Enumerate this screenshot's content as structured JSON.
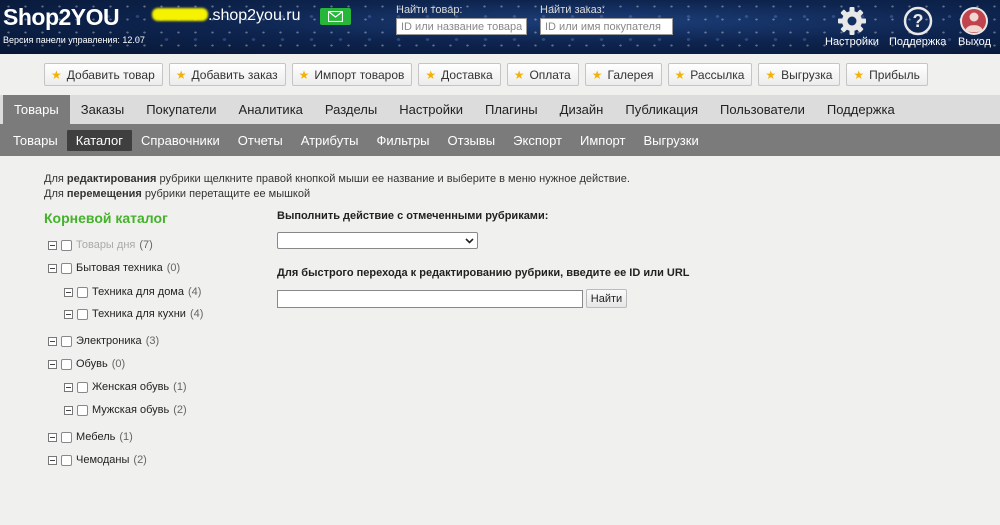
{
  "header": {
    "logo": "Shop2YOU",
    "version": "Версия панели управления: 12.07",
    "domain_visible": ".shop2you.ru",
    "search_product": {
      "label": "Найти товар:",
      "placeholder": "ID или название товара"
    },
    "search_order": {
      "label": "Найти заказ:",
      "placeholder": "ID или имя покупателя"
    },
    "nav": {
      "settings": "Настройки",
      "support": "Поддержка",
      "logout": "Выход"
    },
    "colors": {
      "accent_green": "#27b53a",
      "avatar_red": "#c0434e"
    }
  },
  "quick_buttons": [
    "Добавить товар",
    "Добавить заказ",
    "Импорт товаров",
    "Доставка",
    "Оплата",
    "Галерея",
    "Рассылка",
    "Выгрузка",
    "Прибыль"
  ],
  "main_menu": [
    "Товары",
    "Заказы",
    "Покупатели",
    "Аналитика",
    "Разделы",
    "Настройки",
    "Плагины",
    "Дизайн",
    "Публикация",
    "Пользователи",
    "Поддержка"
  ],
  "sub_menu": [
    "Товары",
    "Каталог",
    "Справочники",
    "Отчеты",
    "Атрибуты",
    "Фильтры",
    "Отзывы",
    "Экспорт",
    "Импорт",
    "Выгрузки"
  ],
  "hints": {
    "line1_pre": "Для ",
    "line1_bold": "редактирования",
    "line1_post": " рубрики щелкните правой кнопкой мыши ее название и выберите в меню нужное действие.",
    "line2_pre": "Для ",
    "line2_bold": "перемещения",
    "line2_post": " рубрики перетащите ее мышкой"
  },
  "tree": {
    "title": "Корневой каталог",
    "items": [
      {
        "name": "Товары дня",
        "count": "(7)"
      },
      {
        "name": "Бытовая техника",
        "count": "(0)"
      },
      {
        "name": "Техника для дома",
        "count": "(4)"
      },
      {
        "name": "Техника для кухни",
        "count": "(4)"
      },
      {
        "name": "Электроника",
        "count": "(3)"
      },
      {
        "name": "Обувь",
        "count": "(0)"
      },
      {
        "name": "Женская обувь",
        "count": "(1)"
      },
      {
        "name": "Мужская обувь",
        "count": "(2)"
      },
      {
        "name": "Мебель",
        "count": "(1)"
      },
      {
        "name": "Чемоданы",
        "count": "(2)"
      }
    ]
  },
  "actions": {
    "bulk_label": "Выполнить действие с отмеченными рубриками:",
    "goto_label": "Для быстрого перехода к редактированию рубрики, введите ее ID или URL",
    "goto_button": "Найти"
  }
}
